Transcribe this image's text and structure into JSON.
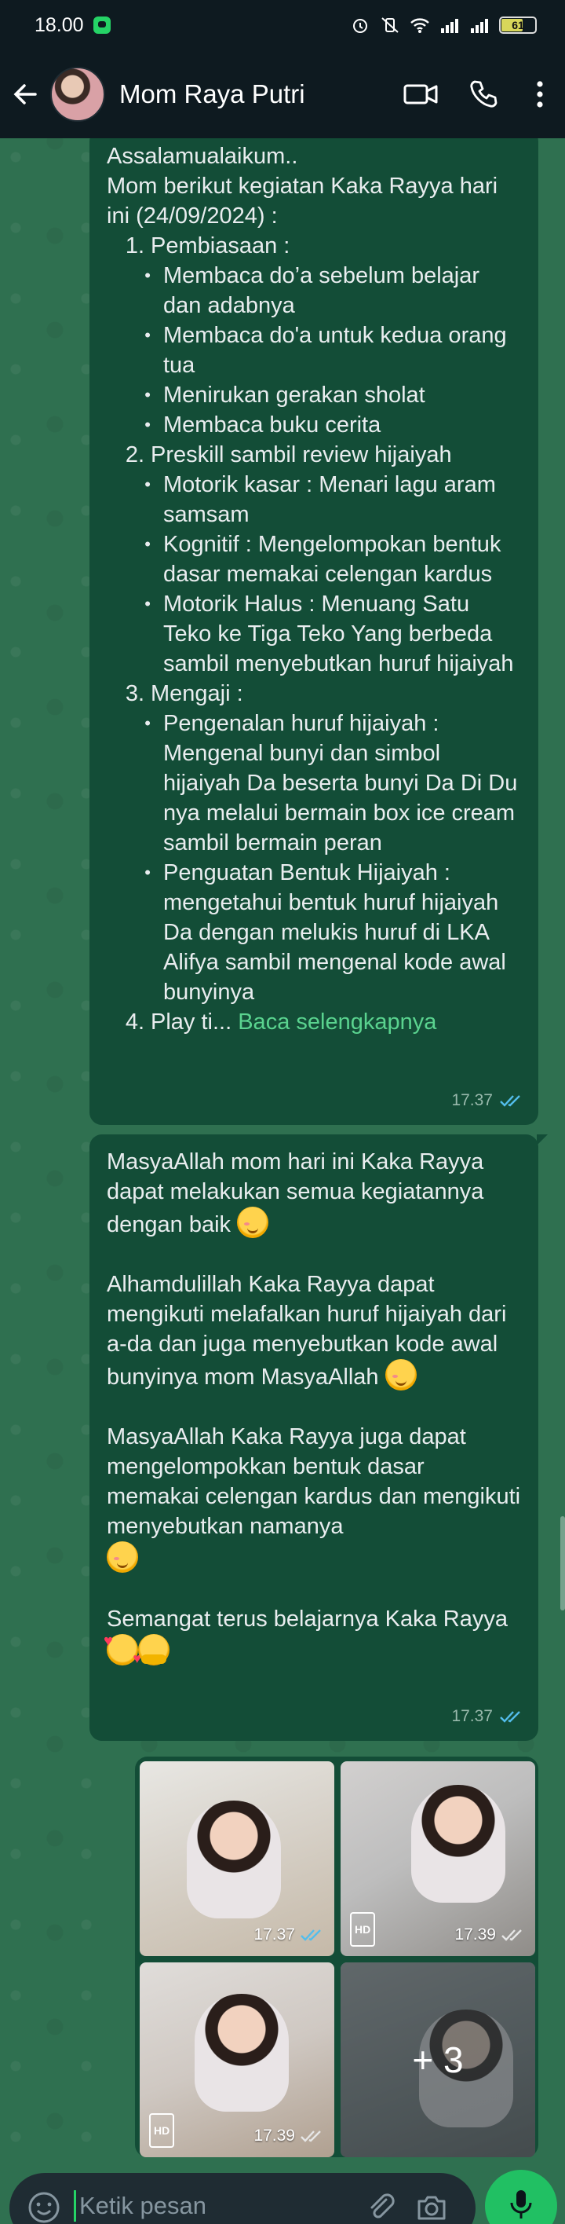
{
  "status_bar": {
    "time": "18.00",
    "battery": "61"
  },
  "header": {
    "contact_name": "Mom Raya Putri"
  },
  "message_1": {
    "lines": [
      {
        "kind": "text",
        "text": "Assalamualaikum.."
      },
      {
        "kind": "text",
        "text": "Mom berikut kegiatan Kaka Rayya hari ini (24/09/2024) :"
      },
      {
        "kind": "num",
        "num": "1.",
        "text": "Pembiasaan :"
      },
      {
        "kind": "bullet",
        "text": "Membaca do’a sebelum belajar dan adabnya"
      },
      {
        "kind": "bullet",
        "text": "Membaca do'a untuk kedua orang tua"
      },
      {
        "kind": "bullet",
        "text": "Menirukan gerakan sholat"
      },
      {
        "kind": "bullet",
        "text": "Membaca buku cerita"
      },
      {
        "kind": "num",
        "num": "2.",
        "text": "Preskill sambil review hijaiyah"
      },
      {
        "kind": "bullet",
        "text": "Motorik kasar : Menari lagu aram samsam"
      },
      {
        "kind": "bullet",
        "text": "Kognitif : Mengelompokan bentuk dasar memakai celengan kardus"
      },
      {
        "kind": "bullet",
        "text": "Motorik Halus :   Menuang Satu Teko ke Tiga Teko Yang berbeda sambil menyebutkan huruf hijaiyah"
      },
      {
        "kind": "num",
        "num": "3.",
        "text": "Mengaji :"
      },
      {
        "kind": "bullet",
        "text": "Pengenalan huruf hijaiyah : Mengenal bunyi dan simbol hijaiyah Da beserta bunyi Da Di Du  nya melalui bermain box ice cream sambil bermain peran"
      },
      {
        "kind": "bullet",
        "text": "Penguatan Bentuk Hijaiyah : mengetahui bentuk huruf hijaiyah Da dengan melukis huruf di LKA Alifya sambil mengenal kode awal bunyinya"
      }
    ],
    "truncated_prefix": "4.",
    "truncated_text": "Play ti...",
    "read_more": "Baca selengkapnya",
    "time": "17.37"
  },
  "message_2": {
    "p1": "MasyaAllah mom hari ini Kaka Rayya dapat melakukan semua kegiatannya dengan baik",
    "p2": "Alhamdulillah Kaka Rayya dapat mengikuti melafalkan huruf hijaiyah dari a-da dan juga menyebutkan kode awal bunyinya mom MasyaAllah",
    "p3": "MasyaAllah Kaka Rayya juga dapat mengelompokkan bentuk dasar memakai celengan kardus dan mengikuti menyebutkan namanya",
    "p4": "Semangat terus belajarnya Kaka Rayya",
    "time": "17.37"
  },
  "media": {
    "items": [
      {
        "time": "17.37",
        "hd": false
      },
      {
        "time": "17.39",
        "hd": true,
        "hd_label": "HD"
      },
      {
        "time": "17.39",
        "hd": true,
        "hd_label": "HD"
      },
      {
        "more": "+ 3"
      }
    ]
  },
  "composer": {
    "placeholder": "Ketik pesan"
  },
  "colors": {
    "header_bg": "#0e1a20",
    "bubble_out": "#134d37",
    "accent": "#21c063",
    "link": "#5ad38f"
  }
}
